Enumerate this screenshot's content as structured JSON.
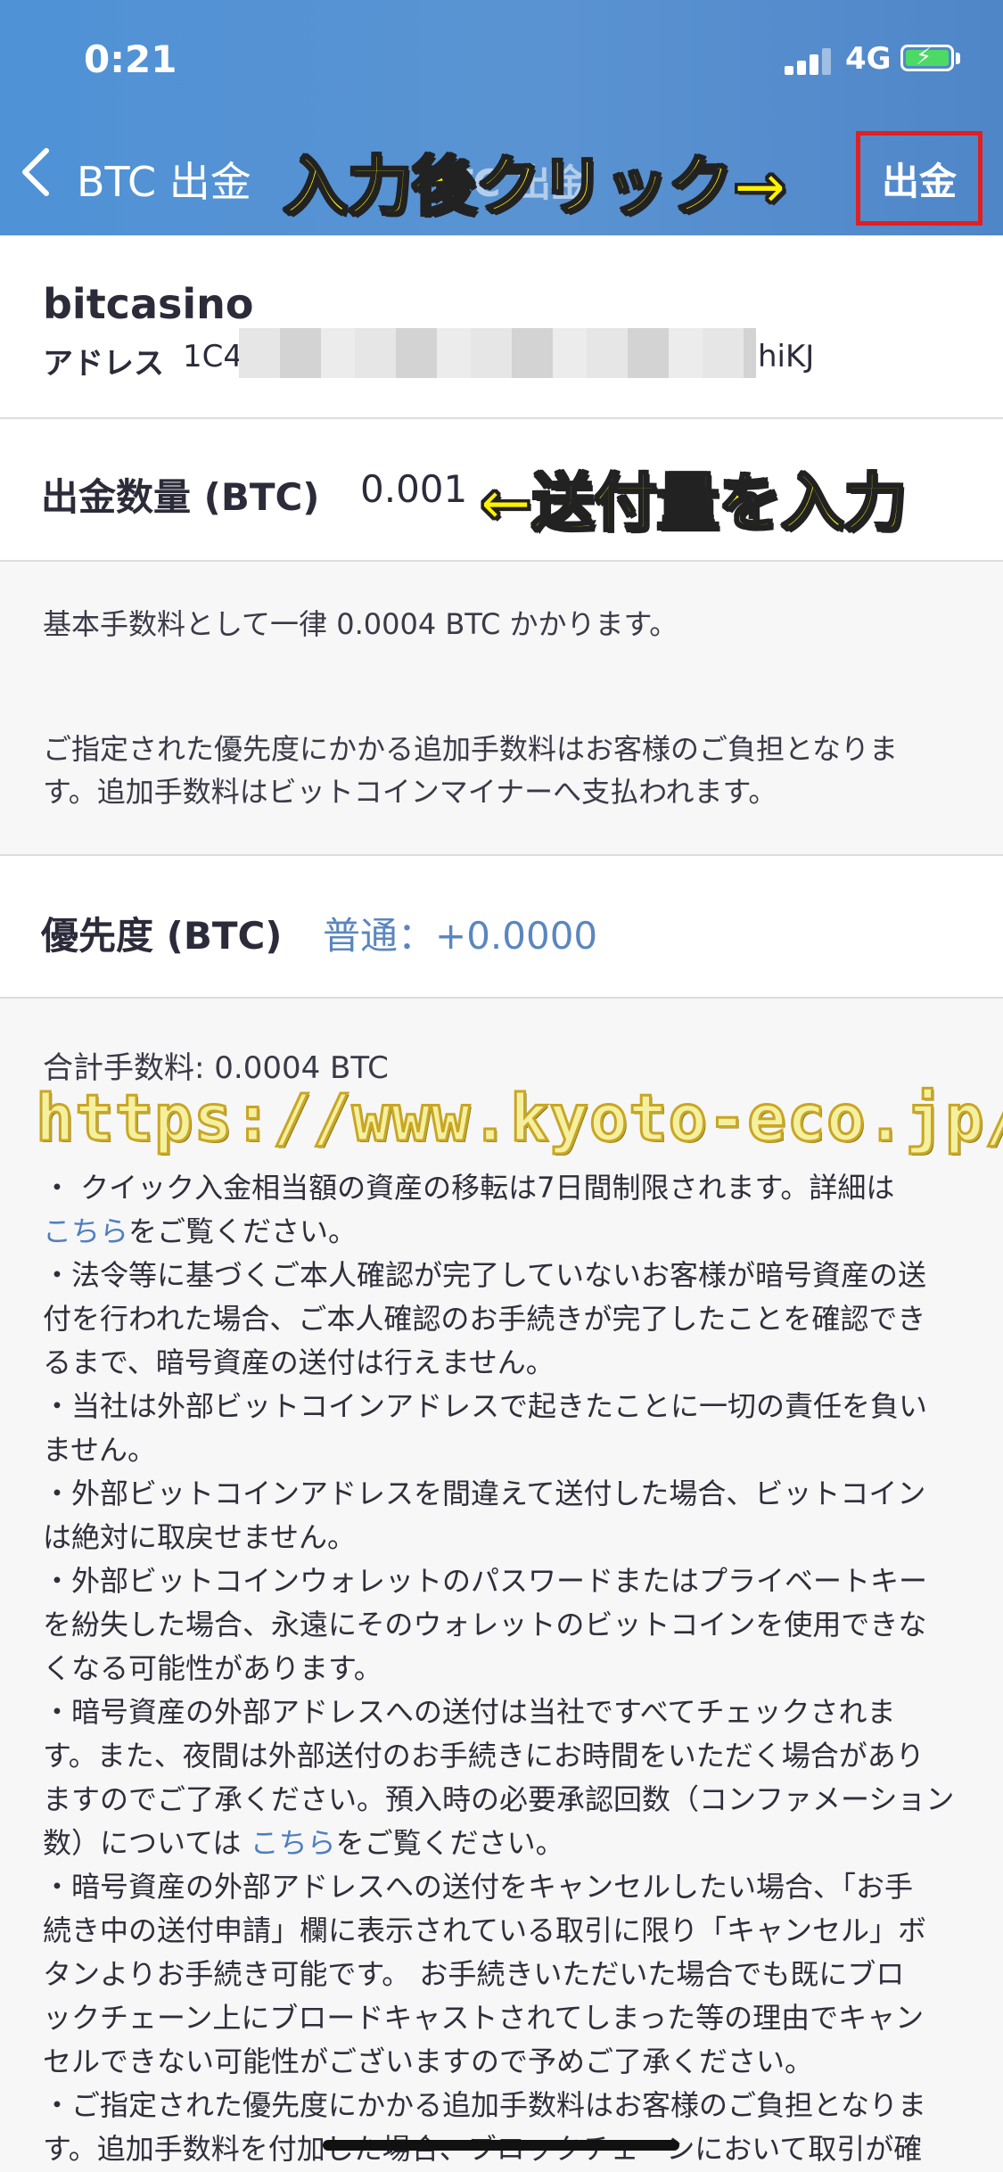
{
  "status_bar": {
    "time": "0:21",
    "network": "4G"
  },
  "nav": {
    "back_label": "BTC 出金",
    "title": "BTC 出金",
    "action_label": "出金",
    "overlay_note": "入力後クリック→"
  },
  "account": {
    "name": "bitcasino",
    "address_label": "アドレス",
    "address_start": "1C4",
    "address_end": "hiKJ"
  },
  "amount": {
    "label": "出金数量 (BTC)",
    "value": "0.001",
    "overlay_note": "←送付量を入力"
  },
  "fee_info": {
    "line1": "基本手数料として一律 0.0004 BTC かかります。",
    "line2a": "ご指定された優先度にかかる追加手数料はお客様のご負担となりま",
    "line2b": "す。追加手数料はビットコインマイナーへ支払われます。"
  },
  "priority": {
    "label": "優先度 (BTC)",
    "value": "普通：+0.0000"
  },
  "total": {
    "label": "合計手数料: 0.0004 BTC"
  },
  "watermark": "https://www.kyoto-eco.jp/",
  "notes": {
    "l1": "・ クイック入金相当額の資産の移転は7日間制限されます。詳細は",
    "l2_link": "こちら",
    "l2_rest": "をご覧ください。",
    "l3": "・法令等に基づくご本人確認が完了していないお客様が暗号資産の送",
    "l4": "付を行われた場合、ご本人確認のお手続きが完了したことを確認でき",
    "l5": "るまで、暗号資産の送付は行えません。",
    "l6": "・当社は外部ビットコインアドレスで起きたことに一切の責任を負い",
    "l7": "ません。",
    "l8": "・外部ビットコインアドレスを間違えて送付した場合、ビットコイン",
    "l9": "は絶対に取戻せません。",
    "l10": "・外部ビットコインウォレットのパスワードまたはプライベートキー",
    "l11": "を紛失した場合、永遠にそのウォレットのビットコインを使用できな",
    "l12": "くなる可能性があります。",
    "l13": "・暗号資産の外部アドレスへの送付は当社ですべてチェックされま",
    "l14": "す。また、夜間は外部送付のお手続きにお時間をいただく場合があり",
    "l15": "ますのでご了承ください。預入時の必要承認回数（コンファメーション",
    "l16a": "数）については ",
    "l16_link": "こちら",
    "l16b": "をご覧ください。",
    "l17": "・暗号資産の外部アドレスへの送付をキャンセルしたい場合、「お手",
    "l18": "続き中の送付申請」欄に表示されている取引に限り「キャンセル」ボ",
    "l19": "タンよりお手続き可能です。 お手続きいただいた場合でも既にブロ",
    "l20": "ックチェーン上にブロードキャストされてしまった等の理由でキャン",
    "l21": "セルできない可能性がございますので予めご了承ください。",
    "l22": "・ご指定された優先度にかかる追加手数料はお客様のご負担となりま",
    "l23": "す。追加手数料を付加した場合、ブロックチェーンにおいて取引が確"
  },
  "colors": {
    "header": "#5a93d2",
    "link": "#4f7fc0",
    "highlight_border": "#e02020",
    "overlay_text": "#fff200"
  }
}
